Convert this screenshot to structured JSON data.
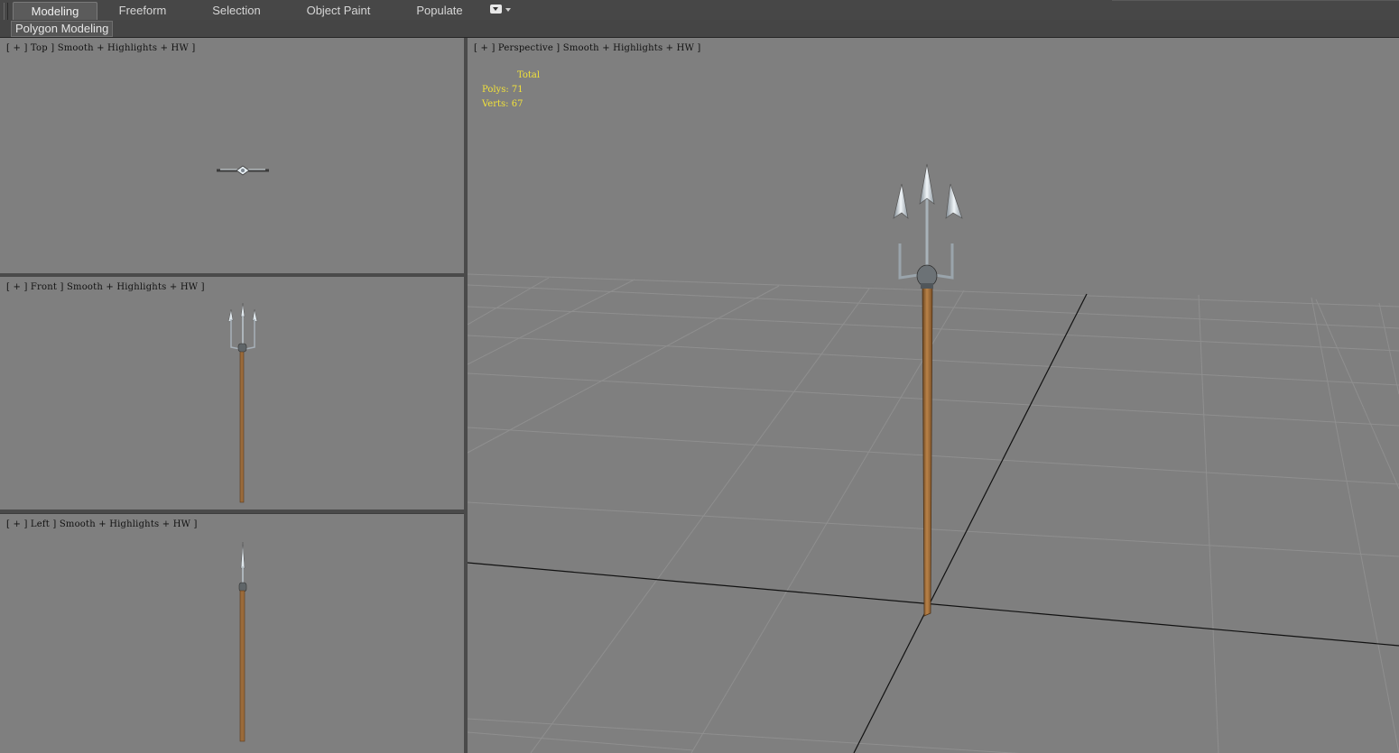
{
  "ribbon": {
    "tabs": [
      {
        "label": "Modeling",
        "active": true
      },
      {
        "label": "Freeform",
        "active": false
      },
      {
        "label": "Selection",
        "active": false
      },
      {
        "label": "Object Paint",
        "active": false
      },
      {
        "label": "Populate",
        "active": false
      }
    ],
    "dropdown_icon": "menu-dropdown-icon",
    "panel_label": "Polygon Modeling"
  },
  "viewports": {
    "top": {
      "label": "[ + ] Top ] Smooth + Highlights + HW ]"
    },
    "front": {
      "label": "[ + ] Front ] Smooth + Highlights + HW ]"
    },
    "left": {
      "label": "[ + ] Left ] Smooth + Highlights + HW ]"
    },
    "perspective": {
      "label": "[ + ] Perspective ] Smooth + Highlights + HW ]"
    }
  },
  "stats": {
    "total_label": "Total",
    "polys_label": "Polys:",
    "polys_value": "71",
    "verts_label": "Verts:",
    "verts_value": "67"
  },
  "colors": {
    "viewport_bg": "#7f7f7f",
    "stats_text": "#f2e23a",
    "shaft": "#a5733f",
    "metal": "#c9d2d8"
  }
}
